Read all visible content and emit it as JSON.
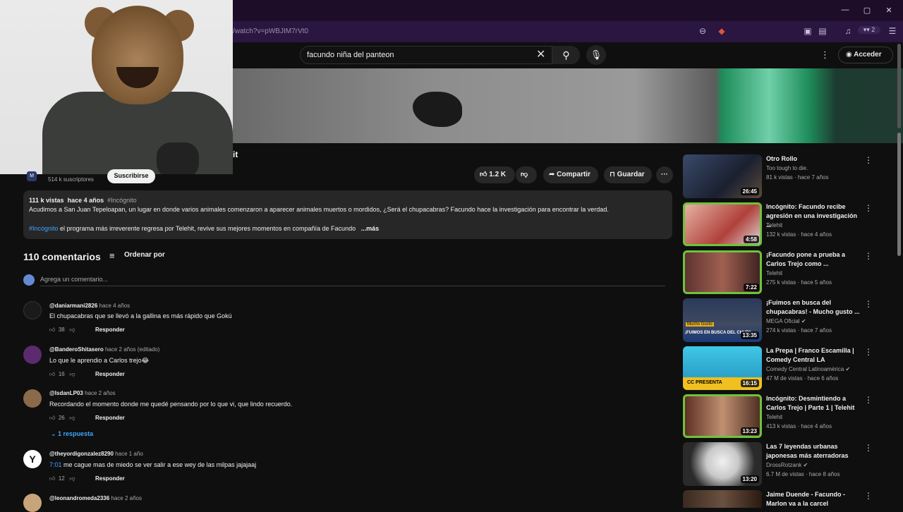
{
  "browser": {
    "url": "/watch?v=pWBJIM7rVt0",
    "ext_badge": "2",
    "window_buttons": [
      "—",
      "▢",
      "✕"
    ]
  },
  "header": {
    "search_value": "facundo niña del panteon",
    "signin_label": "Acceder"
  },
  "video": {
    "title_fragment": "it",
    "subscribers": "514 k suscriptores",
    "subscribe_label": "Suscribirse",
    "likes": "1.2 K",
    "share_label": "Compartir",
    "save_label": "Guardar"
  },
  "description": {
    "views": "111 k vistas",
    "age": "hace 4 años",
    "hashtag": "#Incógnito",
    "text": "Acudimos a San Juan Tepeloapan, un lugar en donde varios animales comenzaron a aparecer animales muertos o mordidos, ¿Será el chupacabras? Facundo hace la investigación para encontrar la verdad.",
    "hashtag2": "#Incógnito",
    "text2": " el programa más irreverente regresa por Telehit, revive sus mejores momentos en compañía de Facundo",
    "more": "...más"
  },
  "comments": {
    "count_label": "110 comentarios",
    "sort_label": "Ordenar por",
    "add_placeholder": "Agrega un comentario...",
    "reply_label": "Responder",
    "replies_label": "1 respuesta",
    "items": [
      {
        "user": "@daniarmani2826",
        "time": "hace 4 años",
        "text": "El chupacabras que se llevó a la gallina es más rápido que Gokú",
        "likes": "38"
      },
      {
        "user": "@BanderoShitasero",
        "time": "hace 2 años (editado)",
        "text": "Lo que le aprendio a Carlos trejo😂",
        "likes": "16"
      },
      {
        "user": "@IsdanLP03",
        "time": "hace 2 años",
        "text": "Recordando el momento donde me quedé pensando por lo que vi, que lindo recuerdo.",
        "likes": "26"
      },
      {
        "user": "@theyordigonzalez8290",
        "time": "hace 1 año",
        "timestamp": "7:01",
        "text": " me cague mas de miedo se ver salir a ese wey de las milpas jajajaaj",
        "likes": "12",
        "avatar_letter": "Y"
      },
      {
        "user": "@leonandromeda2336",
        "time": "hace 2 años"
      }
    ]
  },
  "sidebar": {
    "items": [
      {
        "title": "Otro Rollo",
        "channel": "Too tough to die.",
        "meta": "81 k vistas · hace 7 años",
        "duration": "26:45"
      },
      {
        "title": "Incógnito: Facundo recibe agresión en una investigación ...",
        "channel": "Telehit",
        "meta": "132 k vistas · hace 4 años",
        "duration": "4:58"
      },
      {
        "title": "¡Facundo pone a prueba a Carlos Trejo como ...",
        "channel": "Telehit",
        "meta": "275 k vistas · hace 5 años",
        "duration": "7:22"
      },
      {
        "title": "¡Fuimos en busca del chupacabras! - Mucho gusto ...",
        "channel": "MEGA Oficial",
        "meta": "274 k vistas · hace 7 años",
        "duration": "13:35"
      },
      {
        "title": "La Prepa | Franco Escamilla | Comedy Central LA",
        "channel": "Comedy Central Latinoamérica",
        "meta": "47 M de vistas · hace 6 años",
        "duration": "16:15"
      },
      {
        "title": "Incógnito: Desmintiendo a Carlos Trejo | Parte 1 | Telehit",
        "channel": "Telehit",
        "meta": "413 k vistas · hace 4 años",
        "duration": "13:23"
      },
      {
        "title": "Las 7 leyendas urbanas japonesas más aterradoras",
        "channel": "DrossRotzank",
        "meta": "6.7 M de vistas · hace 8 años",
        "duration": "13:20"
      },
      {
        "title": "Jaime Duende - Facundo - Marlon va a la carcel",
        "channel": "",
        "meta": "",
        "duration": ""
      }
    ],
    "thumb_texts": {
      "t3": "Mucho Gusto",
      "t3b": "¡FUIMOS EN BUSCA DEL CHUPA",
      "t4": "CC PRESENTA"
    }
  },
  "colors": {
    "accent_green": "#6ec33c",
    "link_blue": "#3ea6ff"
  }
}
